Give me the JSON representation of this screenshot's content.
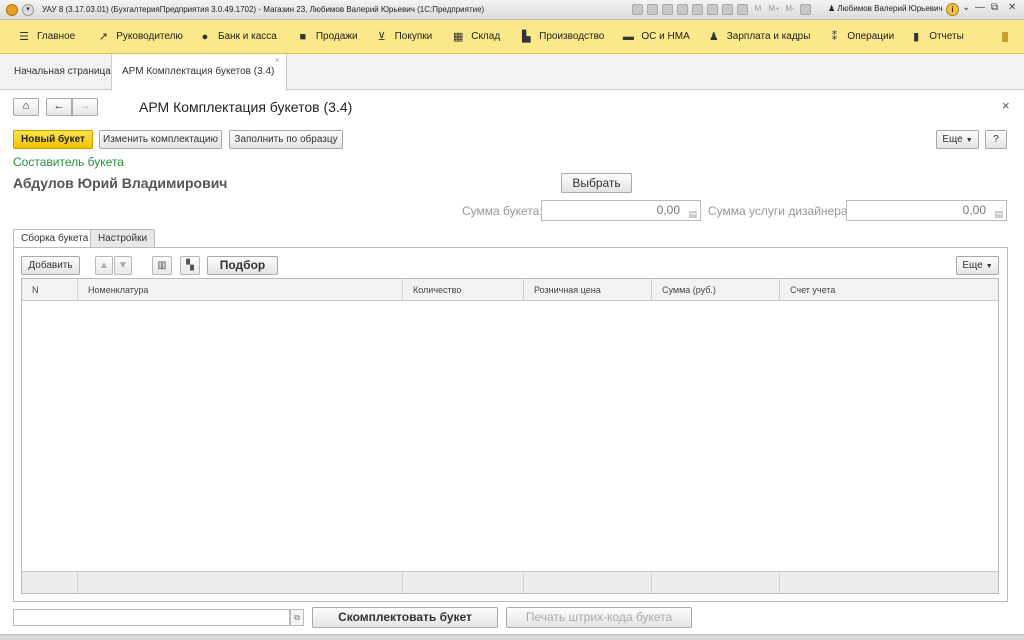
{
  "window": {
    "title": "УАУ 8 (3.17.03.01) (БухгалтерияПредприятия 3.0.49.1702) - Магазин 23, Любимов Валерий Юрьевич  (1С:Предприятие)",
    "tools_m": [
      "M",
      "M+",
      "M-"
    ],
    "user": "Любимов Валерий Юрьевич",
    "info_glyph": "i",
    "minimize_glyph": "—",
    "restore_glyph": "⧉",
    "close_glyph": "✕"
  },
  "sections": [
    {
      "label": "Главное",
      "icon": "menu-icon",
      "glyph": "☰"
    },
    {
      "label": "Руководителю",
      "icon": "trend-icon",
      "glyph": "↗"
    },
    {
      "label": "Банк и касса",
      "icon": "coin-icon",
      "glyph": "●"
    },
    {
      "label": "Продажи",
      "icon": "bag-icon",
      "glyph": "■"
    },
    {
      "label": "Покупки",
      "icon": "cart-icon",
      "glyph": "⊻"
    },
    {
      "label": "Склад",
      "icon": "grid-icon",
      "glyph": "▦"
    },
    {
      "label": "Производство",
      "icon": "factory-icon",
      "glyph": "▙"
    },
    {
      "label": "ОС и НМА",
      "icon": "truck-icon",
      "glyph": "▬"
    },
    {
      "label": "Зарплата и кадры",
      "icon": "person-icon",
      "glyph": "♟"
    },
    {
      "label": "Операции",
      "icon": "operations-icon",
      "glyph": "⁑"
    },
    {
      "label": "Отчеты",
      "icon": "bar-chart-icon",
      "glyph": "▮"
    }
  ],
  "open_tabs": {
    "home": "Начальная страница",
    "active": "АРМ Комплектация букетов (3.4)",
    "close_glyph": "×"
  },
  "form": {
    "title": "АРМ Комплектация букетов (3.4)",
    "close_glyph": "×",
    "home_glyph": "⌂",
    "back_glyph": "←",
    "forward_glyph": "→",
    "buttons": {
      "new_bouquet": "Новый букет",
      "change_composition": "Изменить комплектацию",
      "fill_by_sample": "Заполнить по образцу",
      "more": "Еще",
      "help": "?"
    },
    "composer_label": "Составитель букета",
    "composer_name": "Абдулов Юрий Владимирович",
    "select_button": "Выбрать",
    "bouquet_sum_label": "Сумма букета:",
    "bouquet_sum_value": "0,00",
    "designer_sum_label": "Сумма услуги дизайнера:",
    "designer_sum_value": "0,00",
    "calc_glyph": "▤"
  },
  "panel_tabs": [
    "Сборка букета",
    "Настройки"
  ],
  "toolbar": {
    "add": "Добавить",
    "up_glyph": "▲",
    "down_glyph": "▼",
    "barcode_glyph": "▥",
    "scan_glyph": "▚",
    "pick": "Подбор",
    "more": "Еще"
  },
  "table": {
    "columns": [
      "N",
      "Номенклатура",
      "Количество",
      "Розничная цена",
      "Сумма (руб.)",
      "Счет учета"
    ]
  },
  "bottom": {
    "open_glyph": "⧉",
    "assemble": "Скомплектовать букет",
    "print_barcode": "Печать штрих-кода букета"
  }
}
